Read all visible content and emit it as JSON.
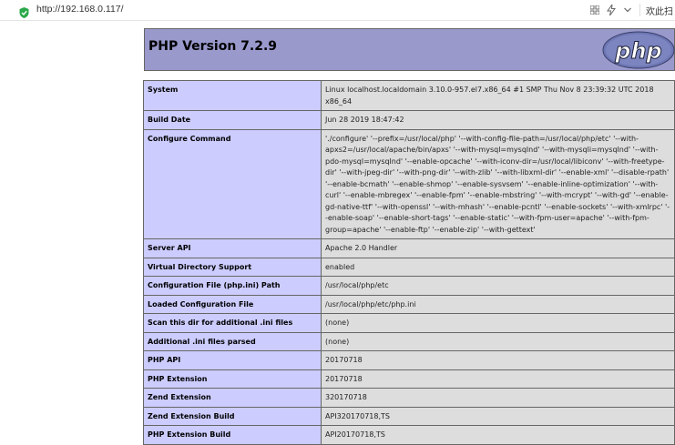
{
  "browser": {
    "url": "http://192.168.0.117/",
    "right_text": "欢此扫"
  },
  "header": {
    "title": "PHP Version 7.2.9",
    "logo_text": "php"
  },
  "rows": [
    {
      "key": "System",
      "value": "Linux localhost.localdomain 3.10.0-957.el7.x86_64 #1 SMP Thu Nov 8 23:39:32 UTC 2018 x86_64"
    },
    {
      "key": "Build Date",
      "value": "Jun 28 2019 18:47:42"
    },
    {
      "key": "Configure Command",
      "value": "'./configure' '--prefix=/usr/local/php' '--with-config-file-path=/usr/local/php/etc' '--with-apxs2=/usr/local/apache/bin/apxs' '--with-mysql=mysqlnd' '--with-mysqli=mysqlnd' '--with-pdo-mysql=mysqlnd' '--enable-opcache' '--with-iconv-dir=/usr/local/libiconv' '--with-freetype-dir' '--with-jpeg-dir' '--with-png-dir' '--with-zlib' '--with-libxml-dir' '--enable-xml' '--disable-rpath' '--enable-bcmath' '--enable-shmop' '--enable-sysvsem' '--enable-inline-optimization' '--with-curl' '--enable-mbregex' '--enable-fpm' '--enable-mbstring' '--with-mcrypt' '--with-gd' '--enable-gd-native-ttf' '--with-openssl' '--with-mhash' '--enable-pcntl' '--enable-sockets' '--with-xmlrpc' '--enable-soap' '--enable-short-tags' '--enable-static' '--with-fpm-user=apache' '--with-fpm-group=apache' '--enable-ftp' '--enable-zip' '--with-gettext'"
    },
    {
      "key": "Server API",
      "value": "Apache 2.0 Handler"
    },
    {
      "key": "Virtual Directory Support",
      "value": "enabled"
    },
    {
      "key": "Configuration File (php.ini) Path",
      "value": "/usr/local/php/etc"
    },
    {
      "key": "Loaded Configuration File",
      "value": "/usr/local/php/etc/php.ini"
    },
    {
      "key": "Scan this dir for additional .ini files",
      "value": "(none)"
    },
    {
      "key": "Additional .ini files parsed",
      "value": "(none)"
    },
    {
      "key": "PHP API",
      "value": "20170718"
    },
    {
      "key": "PHP Extension",
      "value": "20170718"
    },
    {
      "key": "Zend Extension",
      "value": "320170718"
    },
    {
      "key": "Zend Extension Build",
      "value": "API320170718,TS"
    },
    {
      "key": "PHP Extension Build",
      "value": "API20170718,TS"
    }
  ]
}
